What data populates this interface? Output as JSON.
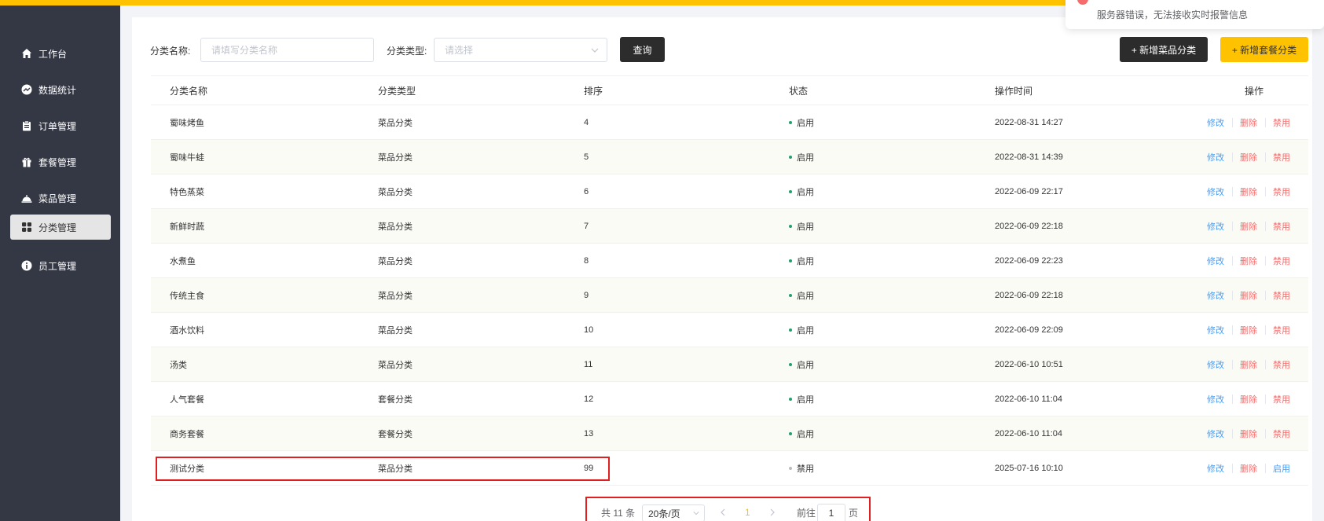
{
  "sidebar": {
    "items": [
      {
        "label": "工作台",
        "icon": "home-icon"
      },
      {
        "label": "数据统计",
        "icon": "chart-icon"
      },
      {
        "label": "订单管理",
        "icon": "clipboard-icon"
      },
      {
        "label": "套餐管理",
        "icon": "gift-icon"
      },
      {
        "label": "菜品管理",
        "icon": "dish-icon"
      },
      {
        "label": "分类管理",
        "icon": "grid-icon",
        "active": true
      },
      {
        "label": "员工管理",
        "icon": "info-icon"
      }
    ]
  },
  "filters": {
    "name_label": "分类名称:",
    "name_placeholder": "请填写分类名称",
    "type_label": "分类类型:",
    "type_placeholder": "请选择",
    "search_button": "查询",
    "add_dish_category_button": "+ 新增菜品分类",
    "add_setmeal_category_button": "+ 新增套餐分类"
  },
  "table": {
    "headers": [
      "分类名称",
      "分类类型",
      "排序",
      "状态",
      "操作时间",
      "操作"
    ],
    "rows": [
      {
        "name": "蜀味烤鱼",
        "type": "菜品分类",
        "sort": "4",
        "status": "启用",
        "time": "2022-08-31 14:27",
        "toggle": "禁用"
      },
      {
        "name": "蜀味牛蛙",
        "type": "菜品分类",
        "sort": "5",
        "status": "启用",
        "time": "2022-08-31 14:39",
        "toggle": "禁用"
      },
      {
        "name": "特色蒸菜",
        "type": "菜品分类",
        "sort": "6",
        "status": "启用",
        "time": "2022-06-09 22:17",
        "toggle": "禁用"
      },
      {
        "name": "新鲜时蔬",
        "type": "菜品分类",
        "sort": "7",
        "status": "启用",
        "time": "2022-06-09 22:18",
        "toggle": "禁用"
      },
      {
        "name": "水煮鱼",
        "type": "菜品分类",
        "sort": "8",
        "status": "启用",
        "time": "2022-06-09 22:23",
        "toggle": "禁用"
      },
      {
        "name": "传统主食",
        "type": "菜品分类",
        "sort": "9",
        "status": "启用",
        "time": "2022-06-09 22:18",
        "toggle": "禁用"
      },
      {
        "name": "酒水饮料",
        "type": "菜品分类",
        "sort": "10",
        "status": "启用",
        "time": "2022-06-09 22:09",
        "toggle": "禁用"
      },
      {
        "name": "汤类",
        "type": "菜品分类",
        "sort": "11",
        "status": "启用",
        "time": "2022-06-10 10:51",
        "toggle": "禁用"
      },
      {
        "name": "人气套餐",
        "type": "套餐分类",
        "sort": "12",
        "status": "启用",
        "time": "2022-06-10 11:04",
        "toggle": "禁用"
      },
      {
        "name": "商务套餐",
        "type": "套餐分类",
        "sort": "13",
        "status": "启用",
        "time": "2022-06-10 11:04",
        "toggle": "禁用"
      },
      {
        "name": "测试分类",
        "type": "菜品分类",
        "sort": "99",
        "status": "禁用",
        "time": "2025-07-16 10:10",
        "toggle": "启用"
      }
    ],
    "edit_label": "修改",
    "delete_label": "删除"
  },
  "pagination": {
    "total": "共 11 条",
    "page_size": "20条/页",
    "current_page": "1",
    "goto_label": "前往",
    "goto_value": "1",
    "page_suffix": "页"
  },
  "toast": {
    "message": "服务器错误，无法接收实时报警信息"
  },
  "colors": {
    "accent": "#ffc200",
    "sidebar": "#343744",
    "enabled_dot": "#22a06b",
    "disabled_dot": "#bbbbbb",
    "link": "#419eff",
    "danger": "#f56c6c"
  }
}
